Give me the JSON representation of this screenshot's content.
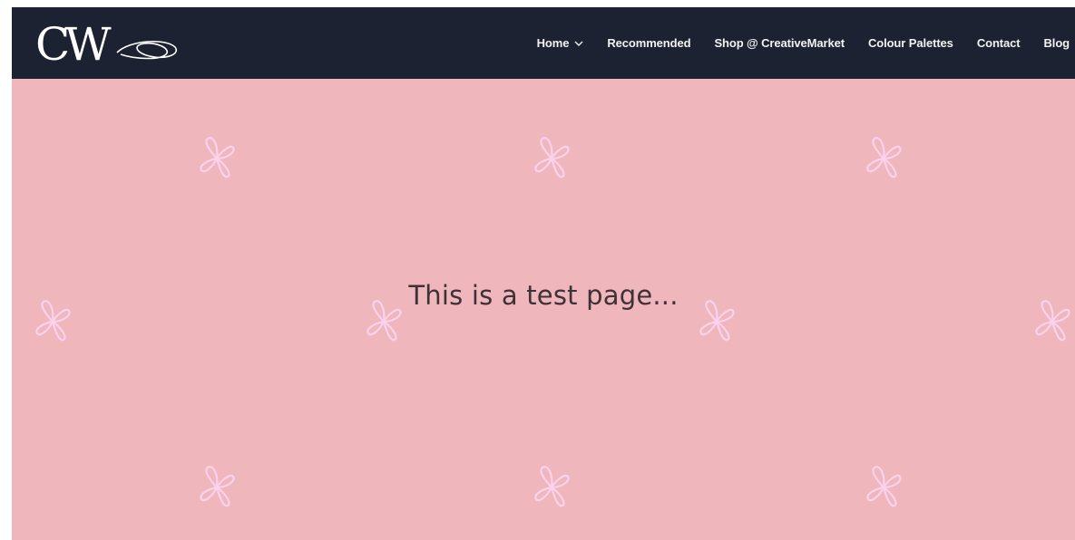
{
  "header": {
    "logo": {
      "text": "CW",
      "icon": "cw-monogram-logo"
    },
    "nav": [
      {
        "label": "Home",
        "has_dropdown": true,
        "dropdown_icon": "chevron-down-icon"
      },
      {
        "label": "Recommended"
      },
      {
        "label": "Shop @ CreativeMarket"
      },
      {
        "label": "Colour Palettes"
      },
      {
        "label": "Contact"
      },
      {
        "label": "Blog"
      }
    ]
  },
  "hero": {
    "headline": "This is a test page...",
    "pattern_icon": "bow-icon"
  },
  "colors": {
    "header_bg": "#1c2231",
    "hero_bg": "#efb6bc",
    "pattern": "#fbd2ee",
    "nav_text": "#f2f2f2",
    "headline_text": "#3d3236"
  }
}
